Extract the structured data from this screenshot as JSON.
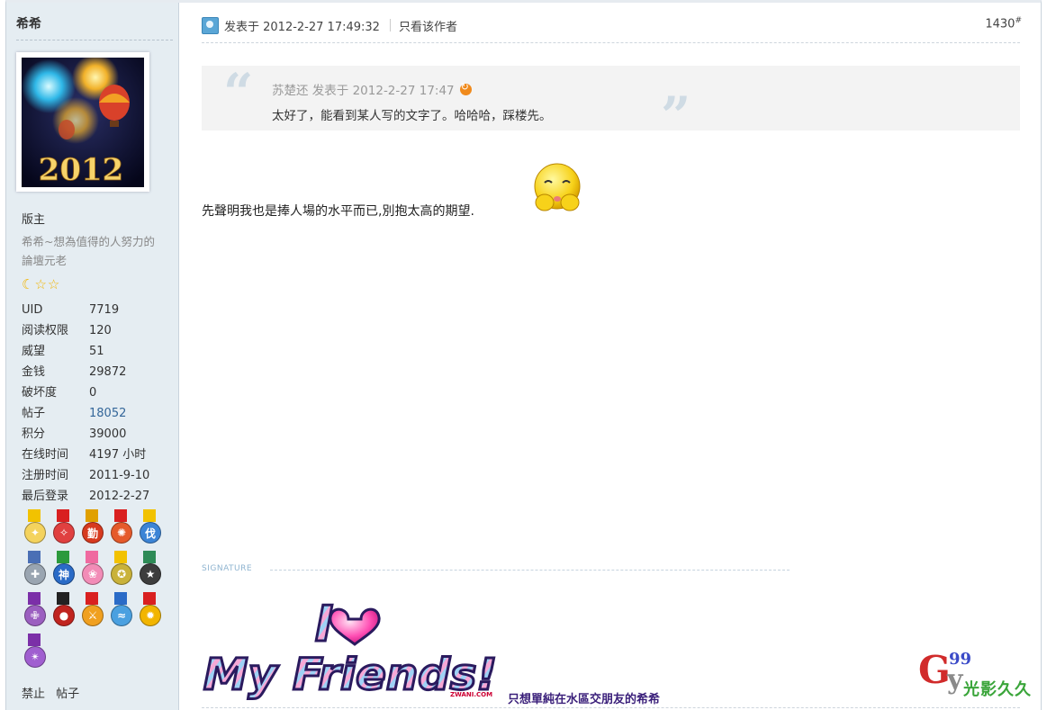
{
  "sidebar": {
    "author": "希希",
    "group": "版主",
    "custom_title": "希希~想為值得的人努力的論壇元老",
    "avatar_year": "2012",
    "stars": [
      "moon-icon",
      "star-icon",
      "star-icon"
    ],
    "stats": [
      {
        "label": "UID",
        "value": "7719",
        "link": false
      },
      {
        "label": "阅读权限",
        "value": "120",
        "link": false
      },
      {
        "label": "威望",
        "value": "51",
        "link": false
      },
      {
        "label": "金钱",
        "value": "29872",
        "link": false
      },
      {
        "label": "破坏度",
        "value": "0",
        "link": false
      },
      {
        "label": "帖子",
        "value": "18052",
        "link": true
      },
      {
        "label": "积分",
        "value": "39000",
        "link": false
      },
      {
        "label": "在线时间",
        "value": "4197 小时",
        "link": false
      },
      {
        "label": "注册时间",
        "value": "2011-9-10",
        "link": false
      },
      {
        "label": "最后登录",
        "value": "2012-2-27",
        "link": false
      }
    ],
    "medals": [
      {
        "name": "wand-medal",
        "rib": "#f2c200",
        "disc": "#f4d35e",
        "glyph": "✦"
      },
      {
        "name": "compass-medal",
        "rib": "#d92020",
        "disc": "#e04040",
        "glyph": "✧"
      },
      {
        "name": "diligence-medal",
        "rib": "#e0a000",
        "disc": "#d73a1f",
        "glyph": "勤"
      },
      {
        "name": "sun-medal",
        "rib": "#d92020",
        "disc": "#e55a2b",
        "glyph": "✺"
      },
      {
        "name": "shield-medal",
        "rib": "#f2c200",
        "disc": "#3c84d6",
        "glyph": "伐"
      },
      {
        "name": "cross-medal",
        "rib": "#4a6fb5",
        "disc": "#9aa5b1",
        "glyph": "✚"
      },
      {
        "name": "god-medal",
        "rib": "#2c9a3c",
        "disc": "#2a6bc7",
        "glyph": "神"
      },
      {
        "name": "flower-medal",
        "rib": "#ef6aa0",
        "disc": "#f28cb7",
        "glyph": "❀"
      },
      {
        "name": "laurel-medal",
        "rib": "#f2c200",
        "disc": "#c9b23a",
        "glyph": "✪"
      },
      {
        "name": "star-badge-medal",
        "rib": "#2e8b57",
        "disc": "#3d3d3d",
        "glyph": "★"
      },
      {
        "name": "purple-cross-medal",
        "rib": "#7b2fa8",
        "disc": "#9b5fc0",
        "glyph": "✙"
      },
      {
        "name": "ball-medal",
        "rib": "#222222",
        "disc": "#c0241f",
        "glyph": "●"
      },
      {
        "name": "swords-medal",
        "rib": "#d92020",
        "disc": "#f0a020",
        "glyph": "⚔"
      },
      {
        "name": "blue-medal",
        "rib": "#2a6bc7",
        "disc": "#4aa0e0",
        "glyph": "≈"
      },
      {
        "name": "gold-star-medal",
        "rib": "#d92020",
        "disc": "#f2b500",
        "glyph": "✹"
      },
      {
        "name": "violet-star-medal",
        "rib": "#7b2fa8",
        "disc": "#a05fd0",
        "glyph": "✴"
      }
    ],
    "bottom_links": [
      "禁止",
      "帖子"
    ]
  },
  "post": {
    "posted_at": "发表于 2012-2-27 17:49:32",
    "author_only": "只看该作者",
    "floor": "1430",
    "floor_suffix": "#",
    "quote_author_line": "苏楚还 发表于 2012-2-27 17:47",
    "quote_text": "太好了，能看到某人写的文字了。哈哈哈，踩楼先。",
    "message": "先聲明我也是捧人場的水平而已,別抱太高的期望.",
    "smiley": "shy-smiley-icon"
  },
  "signature": {
    "label": "SIGNATURE",
    "image_line1": "I",
    "image_line2": "My Friends!",
    "image_credit": "ZWANI.COM",
    "text": "只想單純在水區交朋友的希希"
  },
  "watermark": {
    "letter_g": "G",
    "number": "99",
    "letter_y": "y",
    "text": "光影久久"
  },
  "colors": {
    "sidebar_bg": "#e5edf2",
    "link": "#336699",
    "quote_bg": "#f3f3f3",
    "signature_text": "#3a1f7a"
  }
}
